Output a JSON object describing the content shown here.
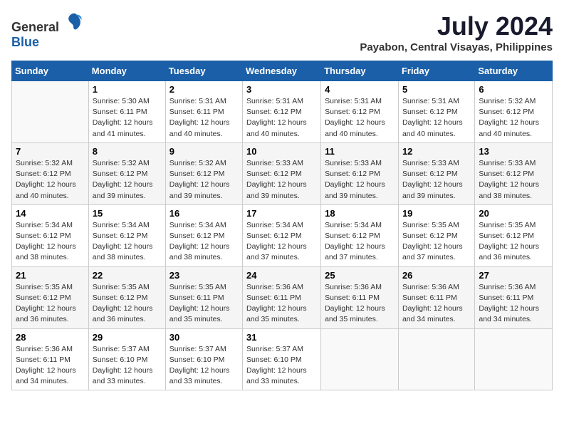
{
  "header": {
    "logo_general": "General",
    "logo_blue": "Blue",
    "month_year": "July 2024",
    "location": "Payabon, Central Visayas, Philippines"
  },
  "calendar": {
    "days_of_week": [
      "Sunday",
      "Monday",
      "Tuesday",
      "Wednesday",
      "Thursday",
      "Friday",
      "Saturday"
    ],
    "weeks": [
      [
        {
          "day": "",
          "sunrise": "",
          "sunset": "",
          "daylight": ""
        },
        {
          "day": "1",
          "sunrise": "Sunrise: 5:30 AM",
          "sunset": "Sunset: 6:11 PM",
          "daylight": "Daylight: 12 hours and 41 minutes."
        },
        {
          "day": "2",
          "sunrise": "Sunrise: 5:31 AM",
          "sunset": "Sunset: 6:11 PM",
          "daylight": "Daylight: 12 hours and 40 minutes."
        },
        {
          "day": "3",
          "sunrise": "Sunrise: 5:31 AM",
          "sunset": "Sunset: 6:12 PM",
          "daylight": "Daylight: 12 hours and 40 minutes."
        },
        {
          "day": "4",
          "sunrise": "Sunrise: 5:31 AM",
          "sunset": "Sunset: 6:12 PM",
          "daylight": "Daylight: 12 hours and 40 minutes."
        },
        {
          "day": "5",
          "sunrise": "Sunrise: 5:31 AM",
          "sunset": "Sunset: 6:12 PM",
          "daylight": "Daylight: 12 hours and 40 minutes."
        },
        {
          "day": "6",
          "sunrise": "Sunrise: 5:32 AM",
          "sunset": "Sunset: 6:12 PM",
          "daylight": "Daylight: 12 hours and 40 minutes."
        }
      ],
      [
        {
          "day": "7",
          "sunrise": "Sunrise: 5:32 AM",
          "sunset": "Sunset: 6:12 PM",
          "daylight": "Daylight: 12 hours and 40 minutes."
        },
        {
          "day": "8",
          "sunrise": "Sunrise: 5:32 AM",
          "sunset": "Sunset: 6:12 PM",
          "daylight": "Daylight: 12 hours and 39 minutes."
        },
        {
          "day": "9",
          "sunrise": "Sunrise: 5:32 AM",
          "sunset": "Sunset: 6:12 PM",
          "daylight": "Daylight: 12 hours and 39 minutes."
        },
        {
          "day": "10",
          "sunrise": "Sunrise: 5:33 AM",
          "sunset": "Sunset: 6:12 PM",
          "daylight": "Daylight: 12 hours and 39 minutes."
        },
        {
          "day": "11",
          "sunrise": "Sunrise: 5:33 AM",
          "sunset": "Sunset: 6:12 PM",
          "daylight": "Daylight: 12 hours and 39 minutes."
        },
        {
          "day": "12",
          "sunrise": "Sunrise: 5:33 AM",
          "sunset": "Sunset: 6:12 PM",
          "daylight": "Daylight: 12 hours and 39 minutes."
        },
        {
          "day": "13",
          "sunrise": "Sunrise: 5:33 AM",
          "sunset": "Sunset: 6:12 PM",
          "daylight": "Daylight: 12 hours and 38 minutes."
        }
      ],
      [
        {
          "day": "14",
          "sunrise": "Sunrise: 5:34 AM",
          "sunset": "Sunset: 6:12 PM",
          "daylight": "Daylight: 12 hours and 38 minutes."
        },
        {
          "day": "15",
          "sunrise": "Sunrise: 5:34 AM",
          "sunset": "Sunset: 6:12 PM",
          "daylight": "Daylight: 12 hours and 38 minutes."
        },
        {
          "day": "16",
          "sunrise": "Sunrise: 5:34 AM",
          "sunset": "Sunset: 6:12 PM",
          "daylight": "Daylight: 12 hours and 38 minutes."
        },
        {
          "day": "17",
          "sunrise": "Sunrise: 5:34 AM",
          "sunset": "Sunset: 6:12 PM",
          "daylight": "Daylight: 12 hours and 37 minutes."
        },
        {
          "day": "18",
          "sunrise": "Sunrise: 5:34 AM",
          "sunset": "Sunset: 6:12 PM",
          "daylight": "Daylight: 12 hours and 37 minutes."
        },
        {
          "day": "19",
          "sunrise": "Sunrise: 5:35 AM",
          "sunset": "Sunset: 6:12 PM",
          "daylight": "Daylight: 12 hours and 37 minutes."
        },
        {
          "day": "20",
          "sunrise": "Sunrise: 5:35 AM",
          "sunset": "Sunset: 6:12 PM",
          "daylight": "Daylight: 12 hours and 36 minutes."
        }
      ],
      [
        {
          "day": "21",
          "sunrise": "Sunrise: 5:35 AM",
          "sunset": "Sunset: 6:12 PM",
          "daylight": "Daylight: 12 hours and 36 minutes."
        },
        {
          "day": "22",
          "sunrise": "Sunrise: 5:35 AM",
          "sunset": "Sunset: 6:12 PM",
          "daylight": "Daylight: 12 hours and 36 minutes."
        },
        {
          "day": "23",
          "sunrise": "Sunrise: 5:35 AM",
          "sunset": "Sunset: 6:11 PM",
          "daylight": "Daylight: 12 hours and 35 minutes."
        },
        {
          "day": "24",
          "sunrise": "Sunrise: 5:36 AM",
          "sunset": "Sunset: 6:11 PM",
          "daylight": "Daylight: 12 hours and 35 minutes."
        },
        {
          "day": "25",
          "sunrise": "Sunrise: 5:36 AM",
          "sunset": "Sunset: 6:11 PM",
          "daylight": "Daylight: 12 hours and 35 minutes."
        },
        {
          "day": "26",
          "sunrise": "Sunrise: 5:36 AM",
          "sunset": "Sunset: 6:11 PM",
          "daylight": "Daylight: 12 hours and 34 minutes."
        },
        {
          "day": "27",
          "sunrise": "Sunrise: 5:36 AM",
          "sunset": "Sunset: 6:11 PM",
          "daylight": "Daylight: 12 hours and 34 minutes."
        }
      ],
      [
        {
          "day": "28",
          "sunrise": "Sunrise: 5:36 AM",
          "sunset": "Sunset: 6:11 PM",
          "daylight": "Daylight: 12 hours and 34 minutes."
        },
        {
          "day": "29",
          "sunrise": "Sunrise: 5:37 AM",
          "sunset": "Sunset: 6:10 PM",
          "daylight": "Daylight: 12 hours and 33 minutes."
        },
        {
          "day": "30",
          "sunrise": "Sunrise: 5:37 AM",
          "sunset": "Sunset: 6:10 PM",
          "daylight": "Daylight: 12 hours and 33 minutes."
        },
        {
          "day": "31",
          "sunrise": "Sunrise: 5:37 AM",
          "sunset": "Sunset: 6:10 PM",
          "daylight": "Daylight: 12 hours and 33 minutes."
        },
        {
          "day": "",
          "sunrise": "",
          "sunset": "",
          "daylight": ""
        },
        {
          "day": "",
          "sunrise": "",
          "sunset": "",
          "daylight": ""
        },
        {
          "day": "",
          "sunrise": "",
          "sunset": "",
          "daylight": ""
        }
      ]
    ]
  }
}
